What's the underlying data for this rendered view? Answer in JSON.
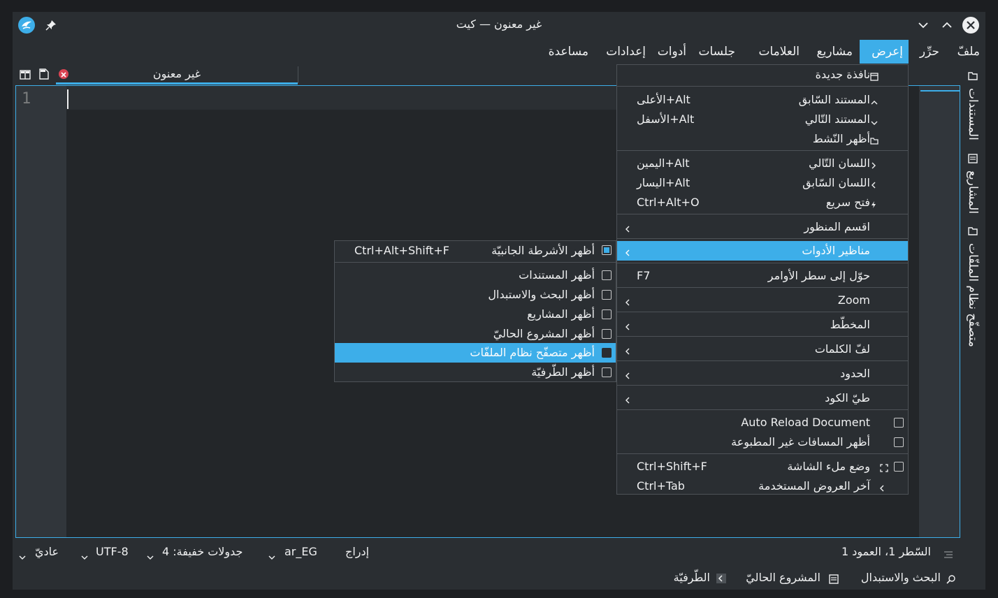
{
  "window": {
    "title": "غير معنون — كيت"
  },
  "menubar": {
    "items": [
      {
        "label": "ملفّ"
      },
      {
        "label": "حرِّر"
      },
      {
        "label": "إعرض"
      },
      {
        "label": "مشاريع"
      },
      {
        "label": "العلامات"
      },
      {
        "label": "جلسات"
      },
      {
        "label": "أدوات"
      },
      {
        "label": "إعدادات"
      },
      {
        "label": "مساعدة"
      }
    ]
  },
  "tab": {
    "label": "غير معنون"
  },
  "editor": {
    "line_number": "1"
  },
  "sidebar": {
    "items": [
      {
        "label": "المستندات",
        "icon": "document-icon"
      },
      {
        "label": "المشاريع",
        "icon": "projects-icon"
      },
      {
        "label": "متصفّح نظام الملفّات",
        "icon": "folder-icon"
      }
    ]
  },
  "view_menu": {
    "items": [
      {
        "label": "نافذة جديدة",
        "shortcut": ""
      },
      {
        "label": "المستند السّابق",
        "shortcut": "Alt+الأعلى"
      },
      {
        "label": "المستند التّالي",
        "shortcut": "Alt+الأسفل"
      },
      {
        "label": "أظهر النّشط",
        "shortcut": ""
      },
      {
        "label": "اللسان التّالي",
        "shortcut": "Alt+اليمين"
      },
      {
        "label": "اللسان السّابق",
        "shortcut": "Alt+اليسار"
      },
      {
        "label": "فتح سريع",
        "shortcut": "Ctrl+Alt+O"
      },
      {
        "label": "اقسم المنظور",
        "shortcut": ""
      },
      {
        "label": "مناظير الأدوات",
        "shortcut": ""
      },
      {
        "label": "حوّل إلى سطر الأوامر",
        "shortcut": "F7"
      },
      {
        "label": "Zoom",
        "shortcut": ""
      },
      {
        "label": "المخطّط",
        "shortcut": ""
      },
      {
        "label": "لفّ الكلمات",
        "shortcut": ""
      },
      {
        "label": "الحدود",
        "shortcut": ""
      },
      {
        "label": "طيّ الكود",
        "shortcut": ""
      },
      {
        "label": "Auto Reload Document",
        "shortcut": ""
      },
      {
        "label": "أظهر المسافات غير المطبوعة",
        "shortcut": ""
      },
      {
        "label": "وضع ملء الشاشة",
        "shortcut": "Ctrl+Shift+F"
      },
      {
        "label": "آخر العروض المستخدمة",
        "shortcut": "Ctrl+Tab"
      }
    ]
  },
  "toolviews_menu": {
    "items": [
      {
        "label": "أظهر الأشرطة الجانبيّة",
        "shortcut": "Ctrl+Alt+Shift+F",
        "checked": true
      },
      {
        "label": "أظهر المستندات",
        "shortcut": "",
        "checked": false
      },
      {
        "label": "أظهر البحث والاستبدال",
        "shortcut": "",
        "checked": false
      },
      {
        "label": "أظهر المشاريع",
        "shortcut": "",
        "checked": false
      },
      {
        "label": "أظهر المشروع الحاليّ",
        "shortcut": "",
        "checked": false
      },
      {
        "label": "أظهر متصفّح نظام الملفّات",
        "shortcut": "",
        "checked": false
      },
      {
        "label": "أظهر الطّرفيّة",
        "shortcut": "",
        "checked": false
      }
    ]
  },
  "statusbar": {
    "position": "السّطر 1، العمود 1",
    "mode": "إدراج",
    "language": "ar_EG",
    "indent": "جدولات خفيفة: 4",
    "encoding": "UTF-8",
    "highlight": "عاديّ"
  },
  "bottombar": {
    "search": "البحث والاستبدال",
    "project": "المشروع الحاليّ",
    "terminal": "الطّرفيّة"
  },
  "colors": {
    "accent": "#3daee9",
    "background": "#2a2e32",
    "editor": "#232629",
    "close": "#da4453"
  }
}
